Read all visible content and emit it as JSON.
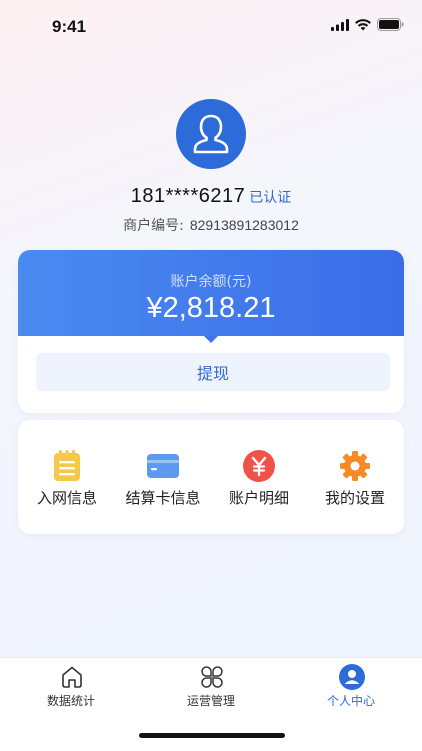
{
  "status_bar": {
    "time": "9:41"
  },
  "profile": {
    "phone": "181****6217",
    "verified_label": "已认证",
    "merchant_label": "商户编号:",
    "merchant_id": "82913891283012"
  },
  "balance": {
    "label": "账户余额(元)",
    "amount": "¥2,818.21",
    "withdraw_label": "提现"
  },
  "menu": [
    {
      "label": "入网信息",
      "icon": "document-icon",
      "color": "#f5c84a"
    },
    {
      "label": "结算卡信息",
      "icon": "card-icon",
      "color": "#5b9af0"
    },
    {
      "label": "账户明细",
      "icon": "yuan-icon",
      "color": "#f0524a"
    },
    {
      "label": "我的设置",
      "icon": "gear-icon",
      "color": "#f58a26"
    }
  ],
  "tabs": [
    {
      "label": "数据统计",
      "icon": "home-icon"
    },
    {
      "label": "运营管理",
      "icon": "clover-icon"
    },
    {
      "label": "个人中心",
      "icon": "user-icon",
      "active": true
    }
  ],
  "colors": {
    "accent": "#2c6bd9",
    "card_gradient_start": "#4a8bf0",
    "card_gradient_end": "#3b6ce8"
  }
}
